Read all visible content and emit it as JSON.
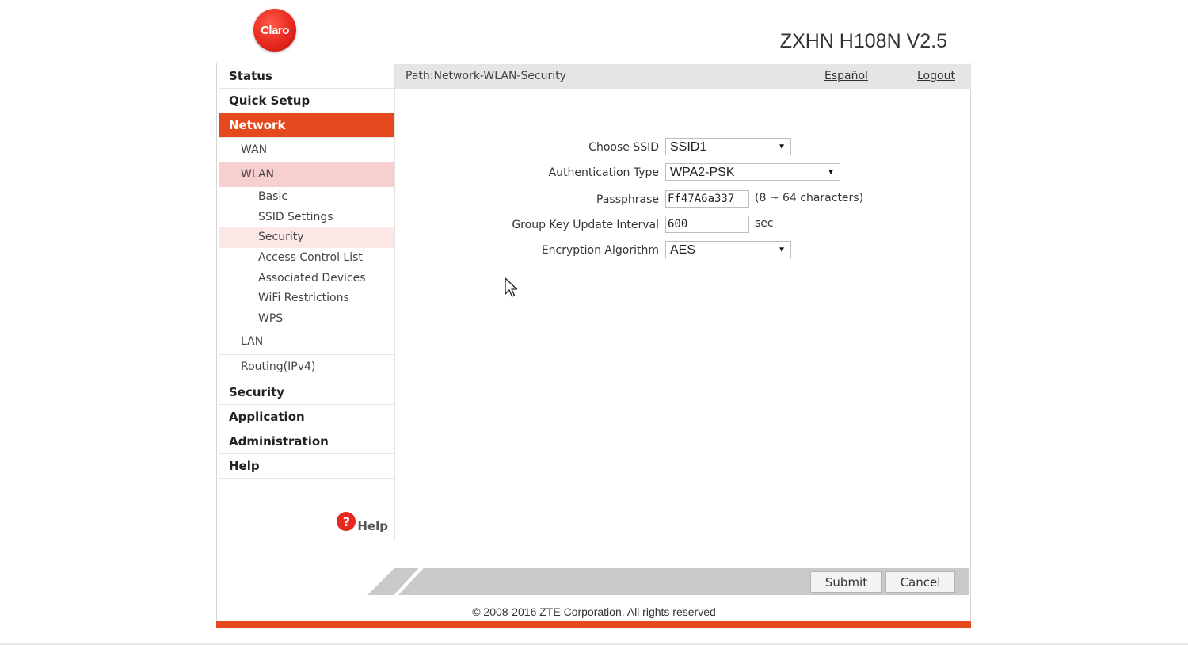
{
  "brand": {
    "logo_text": "Claro",
    "model": "ZXHN H108N V2.5",
    "accent": "#e54a1e"
  },
  "header": {
    "path": "Path:Network-WLAN-Security",
    "language": "Español",
    "logout": "Logout"
  },
  "sidebar": {
    "status": "Status",
    "quick_setup": "Quick Setup",
    "network": "Network",
    "wan": "WAN",
    "wlan": "WLAN",
    "wlan_items": [
      "Basic",
      "SSID Settings",
      "Security",
      "Access Control List",
      "Associated Devices",
      "WiFi Restrictions",
      "WPS"
    ],
    "lan": "LAN",
    "routing": "Routing(IPv4)",
    "security": "Security",
    "application": "Application",
    "administration": "Administration",
    "help": "Help",
    "help_link": "Help",
    "help_icon_glyph": "?"
  },
  "form": {
    "choose_ssid": {
      "label": "Choose SSID",
      "value": "SSID1"
    },
    "auth_type": {
      "label": "Authentication Type",
      "value": "WPA2-PSK"
    },
    "passphrase": {
      "label": "Passphrase",
      "value": "Ff47A6a337",
      "hint": "(8 ~ 64 characters)"
    },
    "group_key": {
      "label": "Group Key Update Interval",
      "value": "600",
      "unit": "sec"
    },
    "encryption": {
      "label": "Encryption Algorithm",
      "value": "AES"
    }
  },
  "buttons": {
    "submit": "Submit",
    "cancel": "Cancel"
  },
  "footer": {
    "copyright": "© 2008-2016 ZTE Corporation. All rights reserved"
  }
}
